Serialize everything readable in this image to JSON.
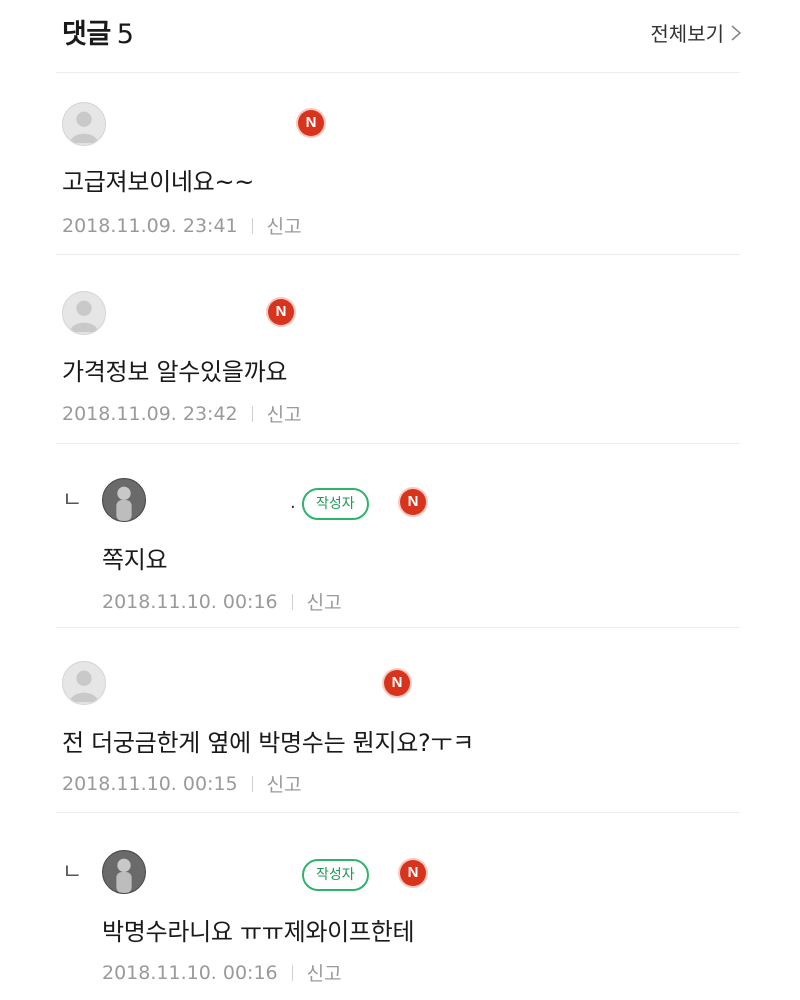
{
  "header": {
    "title": "댓글",
    "count": "5",
    "view_all_label": "전체보기"
  },
  "comments": [
    {
      "is_reply": false,
      "avatar": "default-avatar-icon",
      "badge_n": "N",
      "text": "고급져보이네요~~",
      "date": "2018.11.09. 23:41",
      "report_label": "신고"
    },
    {
      "is_reply": false,
      "avatar": "default-avatar-icon",
      "badge_n": "N",
      "text": "가격정보 알수있을까요",
      "date": "2018.11.09. 23:42",
      "report_label": "신고"
    },
    {
      "is_reply": true,
      "reply_mark": "ㄴ",
      "avatar": "author-photo-avatar",
      "author_badge": "작성자",
      "badge_n": "N",
      "text": "쪽지요",
      "date": "2018.11.10. 00:16",
      "report_label": "신고"
    },
    {
      "is_reply": false,
      "avatar": "default-avatar-icon",
      "badge_n": "N",
      "text": "전 더궁금한게 옆에 박명수는 뭔지요?ㅜㅋ",
      "date": "2018.11.10. 00:15",
      "report_label": "신고"
    },
    {
      "is_reply": true,
      "reply_mark": "ㄴ",
      "avatar": "author-photo-avatar",
      "author_badge": "작성자",
      "badge_n": "N",
      "text": "박명수라니요 ㅠㅠ제와이프한테",
      "date": "2018.11.10. 00:16",
      "report_label": "신고"
    }
  ],
  "colors": {
    "n_badge": "#d8341d",
    "author_badge": "#2fb36a",
    "meta_text": "#9a9a9a"
  }
}
